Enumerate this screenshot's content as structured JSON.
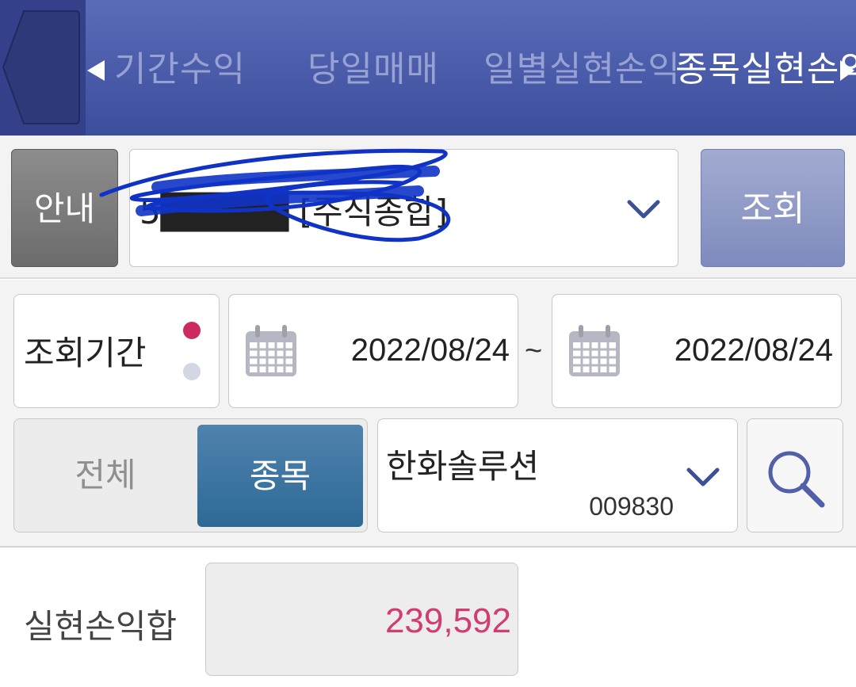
{
  "header": {
    "tabs": [
      {
        "label": "기간수익",
        "active": false
      },
      {
        "label": "당일매매",
        "active": false
      },
      {
        "label": "일별실현손익",
        "active": false
      },
      {
        "label": "종목실현손익",
        "active": true
      }
    ]
  },
  "account": {
    "guide_label": "안내",
    "account_text": "5█████ [주식종합]",
    "query_label": "조회"
  },
  "period": {
    "label": "조회기간",
    "start_date": "2022/08/24",
    "separator": "~",
    "end_date": "2022/08/24",
    "dot_colors": [
      "#cc2a61",
      "#d3d6e3"
    ]
  },
  "filter": {
    "all_label": "전체",
    "item_label": "종목",
    "selected": "종목"
  },
  "stock": {
    "name": "한화솔루션",
    "code": "009830"
  },
  "result": {
    "label": "실현손익합",
    "value": "239,592"
  },
  "colors": {
    "header": "#4a5aab",
    "accent_button": "#3f75a2",
    "value_text": "#d23c72"
  }
}
